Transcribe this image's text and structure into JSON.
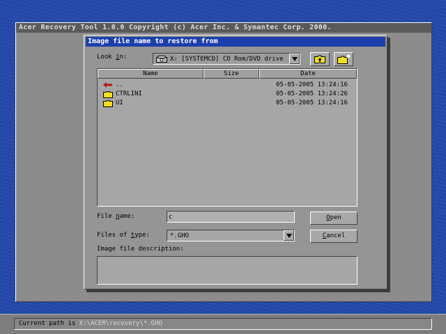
{
  "app": {
    "title": "Acer Recovery Tool 1.0.0   Copyright (c) Acer Inc. & Symantec Corp. 2000."
  },
  "dialog": {
    "title": "Image file name to restore from",
    "look_in_label_pre": "Look ",
    "look_in_label_ul": "i",
    "look_in_label_post": "n:",
    "look_in_value": "X: [SYSTEMCD] CD Rom/DVD drive",
    "columns": [
      "Name",
      "Size",
      "Date"
    ],
    "files": [
      {
        "name": "..",
        "size": "",
        "date": "05-05-2005 13:24:16",
        "icon": "up-arrow-icon"
      },
      {
        "name": "CTRLINI",
        "size": "",
        "date": "05-05-2005 13:24:26",
        "icon": "folder-icon"
      },
      {
        "name": "UI",
        "size": "",
        "date": "05-05-2005 13:24:16",
        "icon": "folder-icon"
      }
    ],
    "file_name_label_pre": "File ",
    "file_name_label_ul": "n",
    "file_name_label_post": "ame:",
    "file_name_value": "c",
    "files_of_type_label_pre": "Files of ",
    "files_of_type_label_ul": "t",
    "files_of_type_label_post": "ype:",
    "files_of_type_value": "*.GHO",
    "open_button_ul": "O",
    "open_button_rest": "pen",
    "cancel_button_ul": "C",
    "cancel_button_rest": "ancel",
    "description_label": "Image file description:",
    "description_value": ""
  },
  "status": {
    "label": "Current path is",
    "path": "X:\\ACER\\recovery\\*.GHO"
  },
  "colors": {
    "desktop": "#1f45a8",
    "dialog_title_bar": "#1d3fae",
    "window_gray": "#8c8c8c",
    "folder_yellow": "#f0e020",
    "up_arrow_red": "#b01818"
  }
}
